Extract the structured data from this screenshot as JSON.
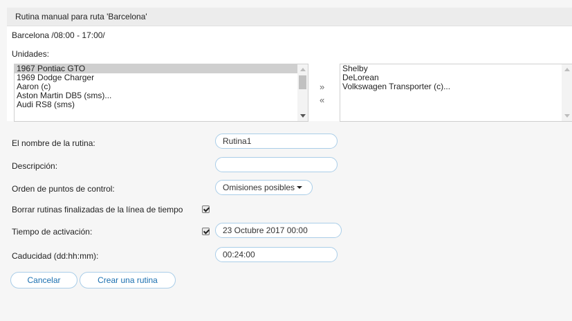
{
  "dialog": {
    "title": "Rutina manual para ruta 'Barcelona'"
  },
  "route_info": "Barcelona   /08:00 - 17:00/",
  "units": {
    "label": "Unidades:",
    "available": [
      "1967 Pontiac GTO",
      "1969 Dodge Charger",
      "Aaron (c)",
      "Aston Martin DB5 (sms)...",
      "Audi RS8 (sms)"
    ],
    "selected": [
      "Shelby",
      "DeLorean",
      "Volkswagen Transporter (c)..."
    ],
    "add_label": "»",
    "remove_label": "«"
  },
  "form": {
    "name_label": "El nombre de la rutina:",
    "name_value": "Rutina1",
    "description_label": "Descripción:",
    "description_value": "",
    "order_label": "Orden de puntos de control:",
    "order_value": "Omisiones posibles",
    "delete_finished_label": "Borrar rutinas finalizadas de la línea de tiempo",
    "delete_finished_checked": true,
    "activation_label": "Tiempo de activación:",
    "activation_checked": true,
    "activation_value": "23 Octubre 2017 00:00",
    "expiry_label": "Caducidad (dd:hh:mm):",
    "expiry_value": "00:24:00"
  },
  "buttons": {
    "cancel": "Cancelar",
    "create": "Crear una rutina"
  }
}
